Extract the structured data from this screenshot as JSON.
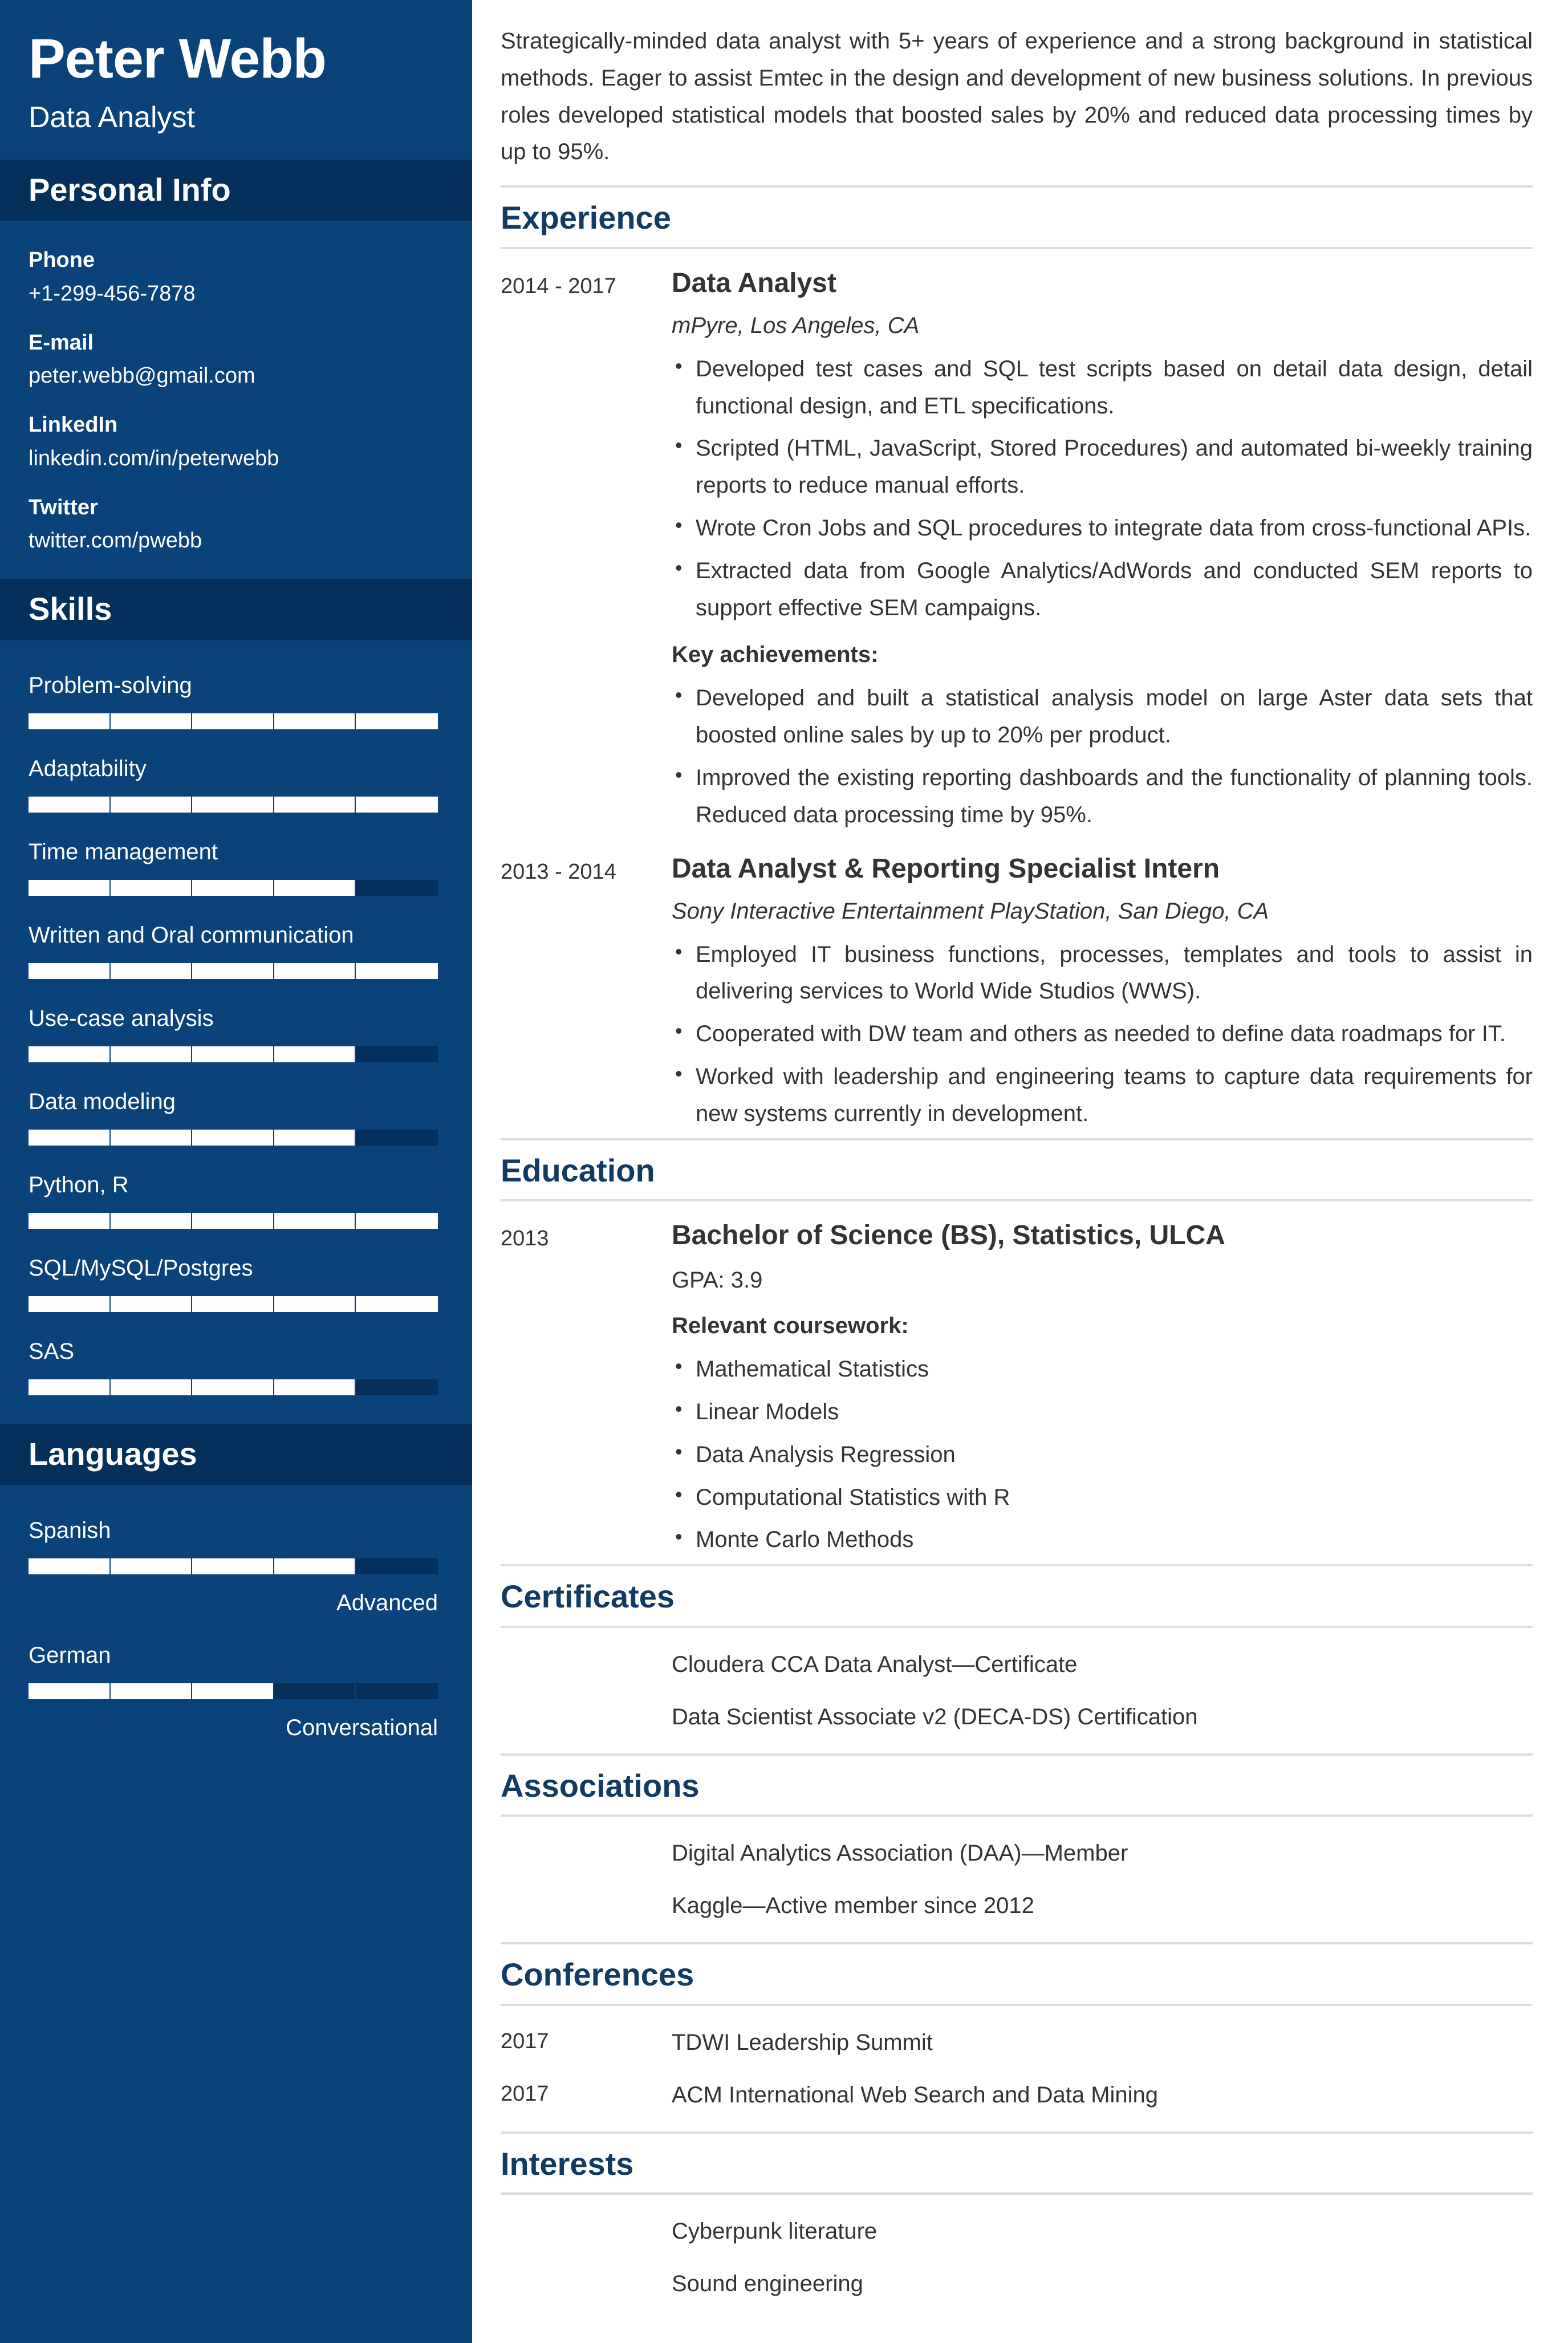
{
  "theme": {
    "sidebar_bg": "#0a4379",
    "sidebar_band_bg": "#04305b",
    "accent_heading": "#123a63",
    "meter_fill": "#ffffff",
    "rule": "#dddddd"
  },
  "sidebar": {
    "name": "Peter Webb",
    "role": "Data Analyst",
    "personal_info": {
      "title": "Personal Info",
      "items": [
        {
          "label": "Phone",
          "value": "+1-299-456-7878"
        },
        {
          "label": "E-mail",
          "value": "peter.webb@gmail.com"
        },
        {
          "label": "LinkedIn",
          "value": "linkedin.com/in/peterwebb"
        },
        {
          "label": "Twitter",
          "value": "twitter.com/pwebb"
        }
      ]
    },
    "skills": {
      "title": "Skills",
      "items": [
        {
          "label": "Problem-solving",
          "level": 5,
          "max": 5
        },
        {
          "label": "Adaptability",
          "level": 5,
          "max": 5
        },
        {
          "label": "Time management",
          "level": 4,
          "max": 5
        },
        {
          "label": "Written and Oral communication",
          "level": 5,
          "max": 5
        },
        {
          "label": "Use-case analysis",
          "level": 4,
          "max": 5
        },
        {
          "label": "Data modeling",
          "level": 4,
          "max": 5
        },
        {
          "label": "Python, R",
          "level": 5,
          "max": 5
        },
        {
          "label": "SQL/MySQL/Postgres",
          "level": 5,
          "max": 5
        },
        {
          "label": "SAS",
          "level": 4,
          "max": 5
        }
      ]
    },
    "languages": {
      "title": "Languages",
      "items": [
        {
          "label": "Spanish",
          "level": 4,
          "max": 5,
          "proficiency": "Advanced"
        },
        {
          "label": "German",
          "level": 3,
          "max": 5,
          "proficiency": "Conversational"
        }
      ]
    }
  },
  "main": {
    "summary": "Strategically-minded data analyst with 5+ years of experience and a strong background in statistical methods. Eager to assist Emtec in the design and development of new business solutions. In previous roles developed statistical models that boosted sales by 20% and reduced data processing times by up to 95%.",
    "experience": {
      "title": "Experience",
      "entries": [
        {
          "date": "2014 - 2017",
          "title": "Data Analyst",
          "org": "mPyre, Los Angeles, CA",
          "bullets": [
            "Developed test cases and SQL test scripts based on detail data design, detail functional design, and ETL specifications.",
            "Scripted (HTML, JavaScript, Stored Procedures) and automated bi-weekly training reports to reduce manual efforts.",
            "Wrote Cron Jobs and SQL procedures to integrate data from cross-functional APIs.",
            "Extracted data from Google Analytics/AdWords and conducted SEM reports to support effective SEM campaigns."
          ],
          "subheading": "Key achievements:",
          "achievements": [
            "Developed and built a statistical analysis model on large Aster data sets that boosted online sales by up to 20% per product.",
            "Improved the existing reporting dashboards and the functionality of planning tools. Reduced data processing time by 95%."
          ]
        },
        {
          "date": "2013 - 2014",
          "title": "Data Analyst & Reporting Specialist Intern",
          "org": "Sony Interactive Entertainment PlayStation, San Diego, CA",
          "bullets": [
            "Employed IT business functions, processes, templates and tools to assist in delivering services to World Wide Studios (WWS).",
            "Cooperated with DW team and others as needed to define data roadmaps for IT.",
            "Worked with leadership and engineering teams to capture data requirements for new systems currently in development."
          ],
          "subheading": "",
          "achievements": []
        }
      ]
    },
    "education": {
      "title": "Education",
      "entries": [
        {
          "date": "2013",
          "title": "Bachelor of Science (BS), Statistics, ULCA",
          "note": "GPA: 3.9",
          "subheading": "Relevant coursework:",
          "bullets": [
            "Mathematical Statistics",
            "Linear Models",
            "Data Analysis Regression",
            "Computational Statistics with R",
            "Monte Carlo Methods"
          ]
        }
      ]
    },
    "certificates": {
      "title": "Certificates",
      "rows": [
        {
          "date": "",
          "text": "Cloudera CCA Data Analyst—Certificate"
        },
        {
          "date": "",
          "text": "Data Scientist Associate v2 (DECA-DS) Certification"
        }
      ]
    },
    "associations": {
      "title": "Associations",
      "rows": [
        {
          "date": "",
          "text": "Digital Analytics Association (DAA)—Member"
        },
        {
          "date": "",
          "text": "Kaggle—Active member since 2012"
        }
      ]
    },
    "conferences": {
      "title": "Conferences",
      "rows": [
        {
          "date": "2017",
          "text": "TDWI Leadership Summit"
        },
        {
          "date": "2017",
          "text": "ACM International Web Search and Data Mining"
        }
      ]
    },
    "interests": {
      "title": "Interests",
      "rows": [
        {
          "date": "",
          "text": "Cyberpunk literature"
        },
        {
          "date": "",
          "text": "Sound engineering"
        }
      ]
    }
  }
}
